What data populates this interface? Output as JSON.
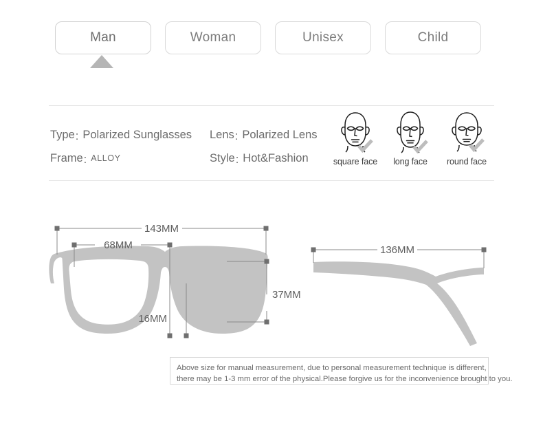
{
  "tabs": [
    {
      "label": "Man",
      "selected": true
    },
    {
      "label": "Woman",
      "selected": false
    },
    {
      "label": "Unisex",
      "selected": false
    },
    {
      "label": "Child",
      "selected": false
    }
  ],
  "specs": [
    {
      "key": "Type",
      "sep": ":",
      "value": "Polarized Sunglasses"
    },
    {
      "key": "Lens",
      "sep": ":",
      "value": "Polarized Lens"
    },
    {
      "key": "Frame",
      "sep": ":",
      "value": "ALLOY"
    },
    {
      "key": "Style",
      "sep": ":",
      "value": "Hot&Fashion"
    }
  ],
  "face_shapes": [
    {
      "label": "square face",
      "icon": "face-square-icon"
    },
    {
      "label": "long face",
      "icon": "face-long-icon"
    },
    {
      "label": "round face",
      "icon": "face-round-icon"
    }
  ],
  "measurements": {
    "front_width": "143MM",
    "lens_span": "68MM",
    "lens_height": "37MM",
    "bridge": "16MM",
    "temple_length": "136MM"
  },
  "note": {
    "line1": "Above size for manual measurement, due to personal measurement technique is different,",
    "line2": "there may be 1-3 mm error of the physical.Please forgive us for the inconvenience brought to you."
  },
  "colors": {
    "frame_gray": "#c3c3c3",
    "tab_border": "#d9d9d9",
    "text_gray": "#6b6b6b",
    "arrow_gray": "#b5b5b5",
    "dim_line": "#8a8a8a"
  }
}
